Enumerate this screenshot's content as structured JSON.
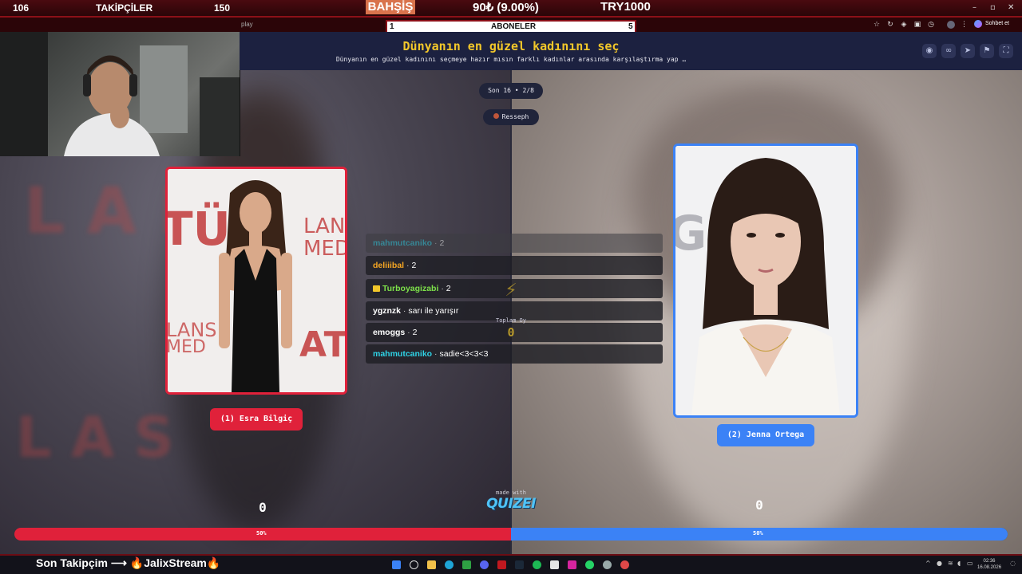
{
  "overlay": {
    "followers_current": "106",
    "followers_label": "TAKİPÇİLER",
    "followers_goal": "150",
    "bahsis_label": "BAHŞİŞ",
    "bahsis_value": "90₺ (9.00%)",
    "bahsis_goal": "TRY1000",
    "subs_current": "1",
    "subs_label": "ABONELER",
    "subs_goal": "5",
    "ticker": "Son Takipçim ⟶ 🔥JalixStream🔥"
  },
  "browser": {
    "tab_fragment": "play",
    "chat_button": "Sohbet et"
  },
  "quiz": {
    "title": "Dünyanın en güzel kadınını seç",
    "subtitle": "Dünyanın en güzel kadınını seçmeye hazır mısın farklı kadınlar arasında karşılaştırma yap …",
    "round_pill": "Son 16 • 2/8",
    "author_pill": "Resseph",
    "total_label": "Toplam Oy",
    "total_value": "0",
    "vs_label": "VS",
    "made_with": "made with",
    "brand": "QUIZEI"
  },
  "contestants": {
    "left": {
      "name": "(1) Esra Bilgiç",
      "votes": "0",
      "percent_label": "50%",
      "percent": 50,
      "color": "#e0213a"
    },
    "right": {
      "name": "(2) Jenna Ortega",
      "votes": "0",
      "percent_label": "50%",
      "percent": 50,
      "color": "#3b82f6"
    }
  },
  "chat": [
    {
      "user": "mahmutcaniko",
      "message": "2",
      "color": "#2fb6c9",
      "dim": true,
      "badge": false
    },
    {
      "user": "deliiibal",
      "message": "2",
      "color": "#f5a623",
      "dim": false,
      "badge": false
    },
    {
      "user": "Turboyagizabi",
      "message": "2",
      "color": "#7ee24a",
      "dim": false,
      "badge": true
    },
    {
      "user": "ygznzk",
      "message": "sarı ile yarışır",
      "color": "#ffffff",
      "dim": false,
      "badge": false
    },
    {
      "user": "emoggs",
      "message": "2",
      "color": "#ffffff",
      "dim": false,
      "badge": false
    },
    {
      "user": "mahmutcaniko",
      "message": "sadie<3<3<3",
      "color": "#2fd3e6",
      "dim": false,
      "badge": false
    }
  ],
  "taskbar": {
    "time": "02:36",
    "date": "16.08.2026"
  }
}
